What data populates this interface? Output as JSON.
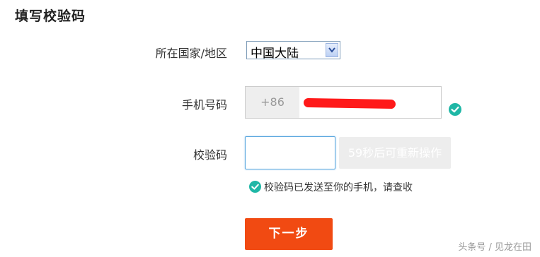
{
  "page": {
    "title": "填写校验码"
  },
  "country": {
    "label": "所在国家/地区",
    "selected": "中国大陆"
  },
  "phone": {
    "label": "手机号码",
    "prefix": "+86"
  },
  "code": {
    "label": "校验码",
    "value": "",
    "resend_label": "59秒后可重新操作"
  },
  "sent_message": "校验码已发送至你的手机，请查收",
  "next_button": "下一步",
  "watermark": "头条号 / 见龙在田",
  "colors": {
    "accent": "#f14a12",
    "check": "#1fb7a6",
    "redaction": "#ff1a1a"
  }
}
